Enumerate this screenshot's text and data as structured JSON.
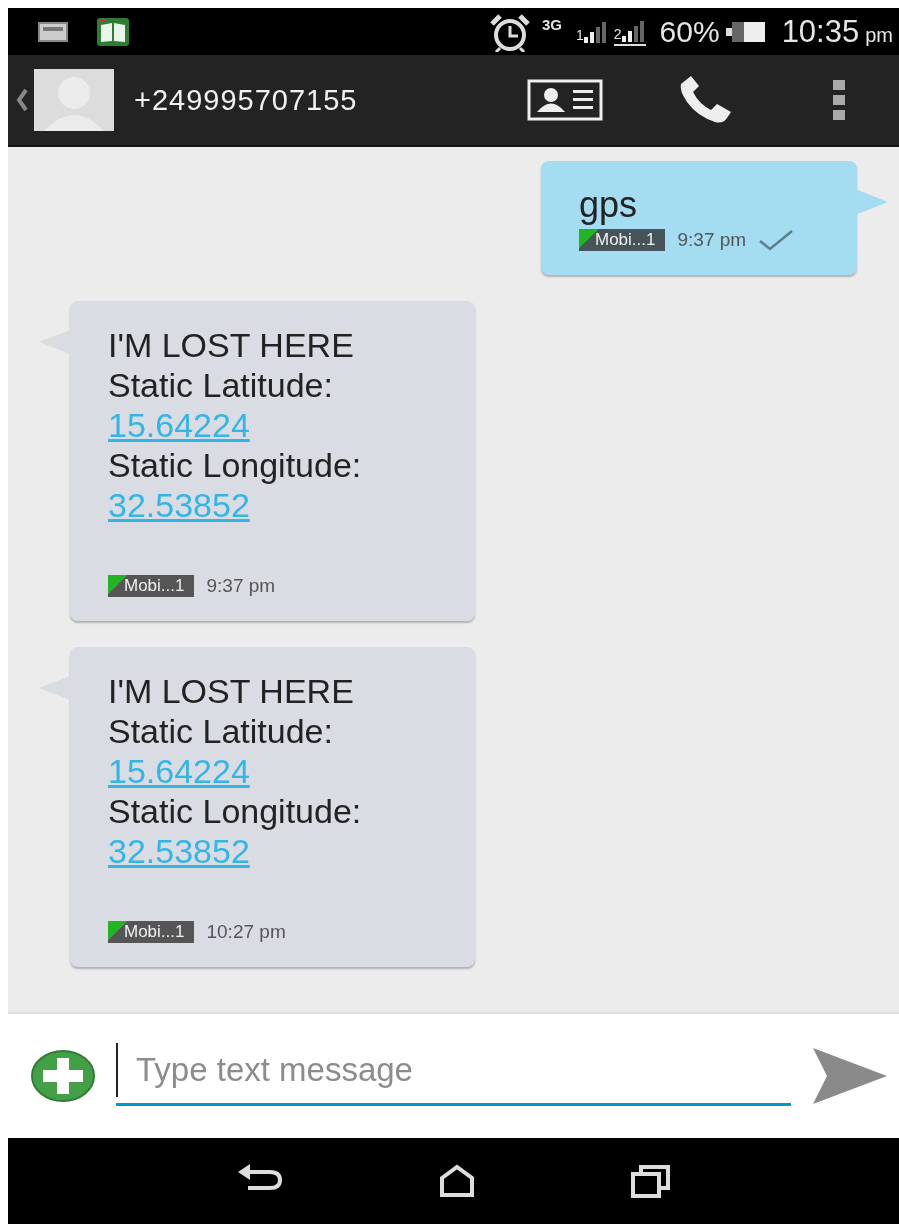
{
  "status_bar": {
    "network": "3G",
    "sim_1": "1",
    "sim_2": "2",
    "battery": "60%",
    "time": "10:35",
    "time_suffix": "pm",
    "sim_2_active": true
  },
  "header": {
    "contact": "+249995707155"
  },
  "messages": [
    {
      "kind": "sent",
      "lines": [
        {
          "kind": "text",
          "text": "gps"
        }
      ],
      "sim": "Mobi...1",
      "time": "9:37 pm",
      "delivered": true
    },
    {
      "kind": "received",
      "lines": [
        {
          "kind": "text",
          "text": "I'M LOST HERE"
        },
        {
          "kind": "text",
          "text": "Static Latitude:"
        },
        {
          "kind": "link",
          "text": "15.64224"
        },
        {
          "kind": "text",
          "text": "Static Longitude:"
        },
        {
          "kind": "link",
          "text": "32.53852"
        }
      ],
      "sim": "Mobi...1",
      "time": "9:37 pm",
      "delivered": false
    },
    {
      "kind": "received",
      "lines": [
        {
          "kind": "text",
          "text": "I'M LOST HERE"
        },
        {
          "kind": "text",
          "text": "Static Latitude:"
        },
        {
          "kind": "link",
          "text": "15.64224"
        },
        {
          "kind": "text",
          "text": "Static Longitude:"
        },
        {
          "kind": "link",
          "text": "32.53852"
        }
      ],
      "sim": "Mobi...1",
      "time": "10:27 pm",
      "delivered": false
    }
  ],
  "composer": {
    "placeholder": "Type text message"
  }
}
